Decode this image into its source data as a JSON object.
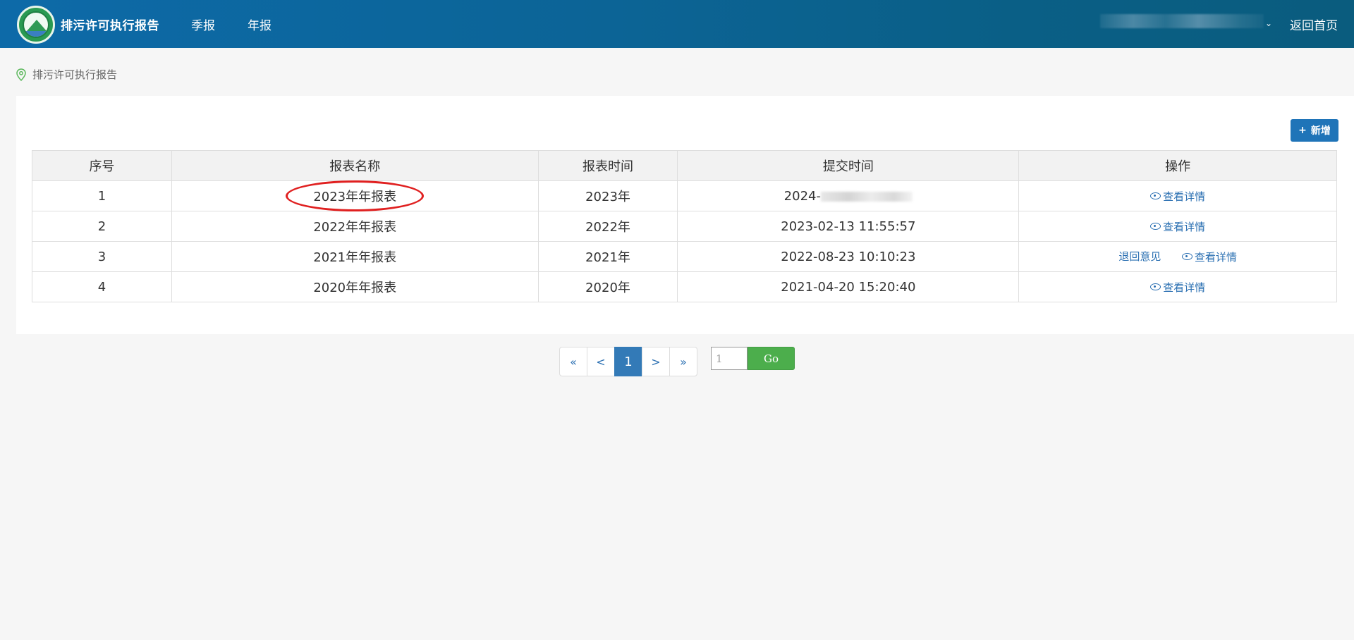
{
  "header": {
    "app_title": "排污许可执行报告",
    "nav": [
      "季报",
      "年报"
    ],
    "home_label": "返回首页"
  },
  "breadcrumb": "排污许可执行报告",
  "toolbar": {
    "add_label": "新增",
    "add_icon": "+"
  },
  "table": {
    "headers": [
      "序号",
      "报表名称",
      "报表时间",
      "提交时间",
      "操作"
    ],
    "rows": [
      {
        "index": "1",
        "name": "2023年年报表",
        "period": "2023年",
        "submitted": "2024-",
        "actions": [
          "查看详情"
        ]
      },
      {
        "index": "2",
        "name": "2022年年报表",
        "period": "2022年",
        "submitted": "2023-02-13 11:55:57",
        "actions": [
          "查看详情"
        ]
      },
      {
        "index": "3",
        "name": "2021年年报表",
        "period": "2021年",
        "submitted": "2022-08-23 10:10:23",
        "actions": [
          "退回意见",
          "查看详情"
        ]
      },
      {
        "index": "4",
        "name": "2020年年报表",
        "period": "2020年",
        "submitted": "2021-04-20 15:20:40",
        "actions": [
          "查看详情"
        ]
      }
    ]
  },
  "pagination": {
    "first": "«",
    "prev": "<",
    "current": "1",
    "next": ">",
    "last": "»",
    "goto_value": "1",
    "go_label": "Go"
  },
  "colors": {
    "header_start": "#0d6aa8",
    "accent": "#1f74b8",
    "go": "#4cae4c",
    "highlight": "#e02020"
  },
  "icons": [
    "logo-emblem",
    "location-pin-icon",
    "chevron-down-icon",
    "eye-icon",
    "plus-icon"
  ]
}
